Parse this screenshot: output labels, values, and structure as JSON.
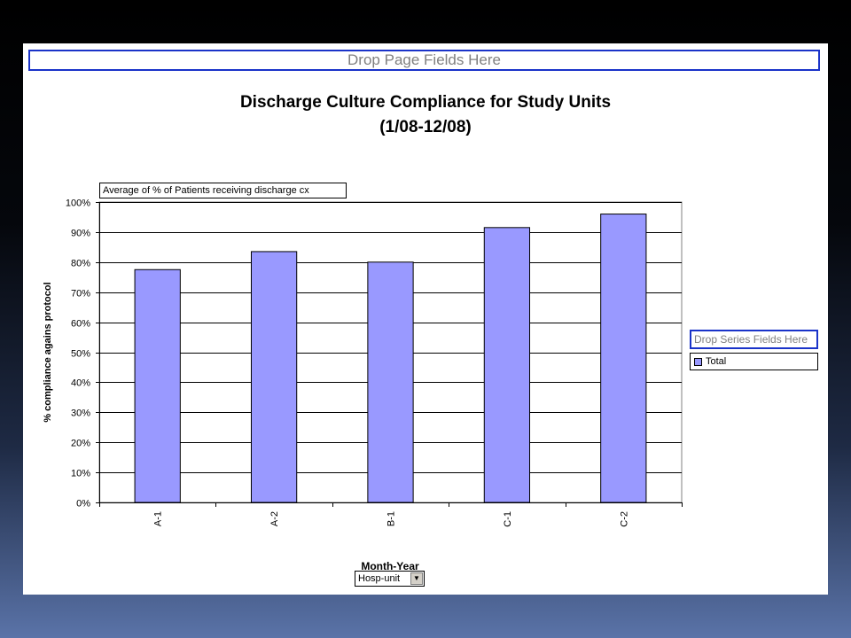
{
  "page_area": {
    "drop_page_label": "Drop Page Fields Here",
    "data_field_label": "Average of % of Patients receiving discharge cx",
    "drop_series_label": "Drop Series Fields Here",
    "category_field_label": "Hosp-unit"
  },
  "chart_data": {
    "type": "bar",
    "title": [
      "Discharge Culture Compliance for Study Units",
      "(1/08-12/08)"
    ],
    "xlabel": "Month-Year",
    "ylabel": "% compliance agains protocol",
    "categories": [
      "A-1",
      "A-2",
      "B-1",
      "C-1",
      "C-2"
    ],
    "series": [
      {
        "name": "Total",
        "values": [
          0.775,
          0.835,
          0.8,
          0.915,
          0.96
        ]
      }
    ],
    "y_ticks": [
      "0%",
      "10%",
      "20%",
      "30%",
      "40%",
      "50%",
      "60%",
      "70%",
      "80%",
      "90%",
      "100%"
    ],
    "ylim": [
      0,
      1
    ],
    "grid": true,
    "legend": "right",
    "colors": {
      "bar": "#9999ff",
      "bar_outline": "#000000",
      "gridline": "#000000"
    }
  }
}
